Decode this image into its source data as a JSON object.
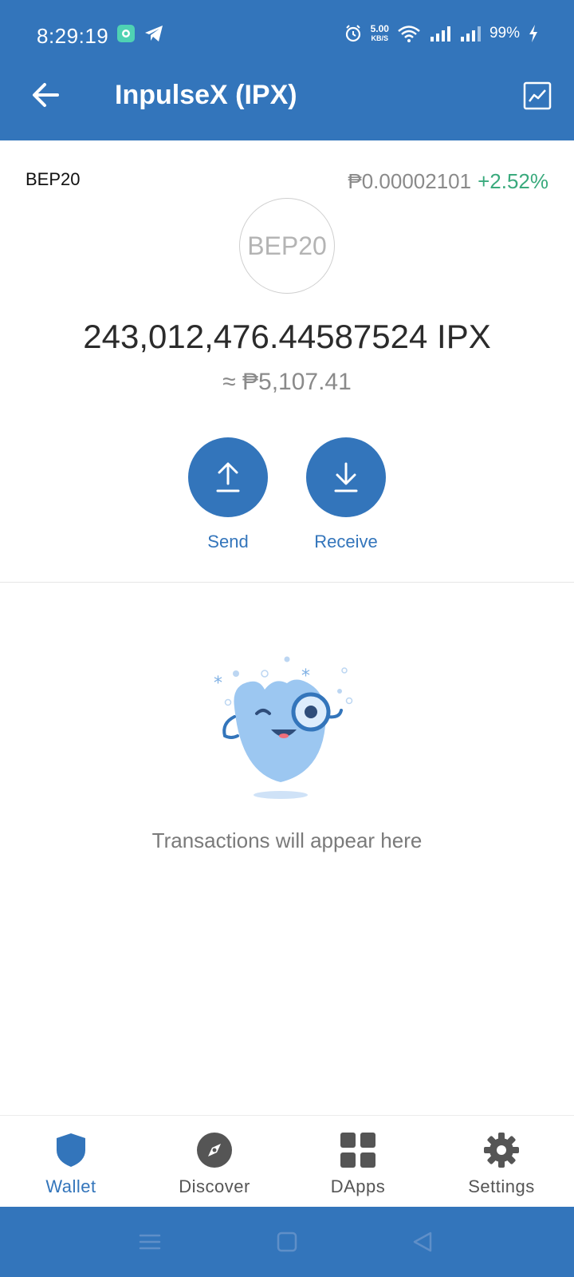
{
  "status_bar": {
    "time": "8:29:19",
    "net_speed_value": "5.00",
    "net_speed_unit": "KB/S",
    "battery": "99%"
  },
  "app_bar": {
    "title": "InpulseX (IPX)"
  },
  "token": {
    "network": "BEP20",
    "price": "₱0.00002101",
    "change": "+2.52%",
    "logo_text": "BEP20",
    "balance": "243,012,476.44587524 IPX",
    "fiat_value": "≈ ₱5,107.41"
  },
  "actions": {
    "send_label": "Send",
    "receive_label": "Receive"
  },
  "empty_state": {
    "message": "Transactions will appear here"
  },
  "bottom_nav": {
    "items": [
      {
        "label": "Wallet",
        "icon": "shield-icon",
        "active": true
      },
      {
        "label": "Discover",
        "icon": "compass-icon",
        "active": false
      },
      {
        "label": "DApps",
        "icon": "grid-icon",
        "active": false
      },
      {
        "label": "Settings",
        "icon": "gear-icon",
        "active": false
      }
    ]
  },
  "colors": {
    "brand": "#3375BB",
    "positive": "#3aaa7d",
    "muted": "#8a8a8a"
  }
}
